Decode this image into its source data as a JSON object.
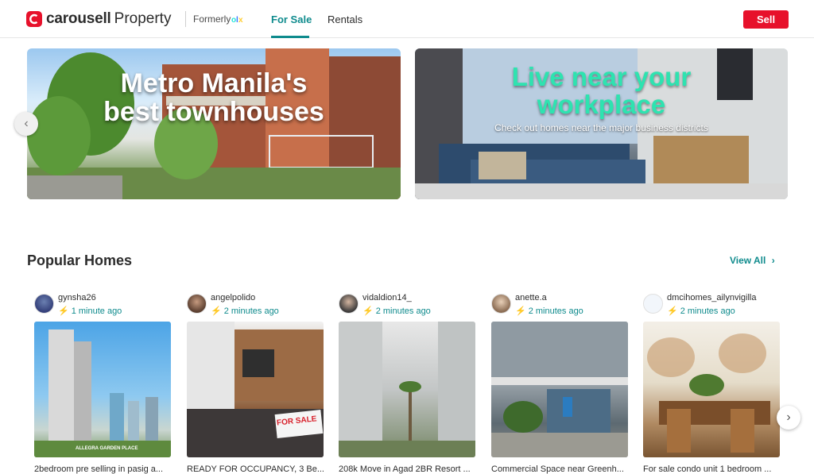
{
  "header": {
    "logo_text": "carousell",
    "logo_sub": "Property",
    "formerly": "Formerly",
    "olx": "OLX",
    "tabs": [
      {
        "label": "For Sale",
        "active": true
      },
      {
        "label": "Rentals",
        "active": false
      }
    ],
    "sell_label": "Sell"
  },
  "banners": [
    {
      "title_line1": "Metro Manila's",
      "title_line2": "best townhouses"
    },
    {
      "title_line1": "Live near your",
      "title_line2": "workplace",
      "subtitle": "Check out homes near the major business districts"
    }
  ],
  "section": {
    "title": "Popular Homes",
    "view_all": "View All"
  },
  "listings": [
    {
      "username": "gynsha26",
      "time": "1 minute ago",
      "caption": "2bedroom pre selling in pasig a...",
      "photo_label": "ALLEGRA GARDEN PLACE"
    },
    {
      "username": "angelpolido",
      "time": "2 minutes ago",
      "caption": "READY FOR OCCUPANCY, 3 Be...",
      "photo_label": "FOR SALE"
    },
    {
      "username": "vidaldion14_",
      "time": "2 minutes ago",
      "caption": "208k Move in Agad 2BR Resort ..."
    },
    {
      "username": "anette.a",
      "time": "2 minutes ago",
      "caption": "Commercial Space near Greenh..."
    },
    {
      "username": "dmcihomes_ailynvigilla",
      "time": "2 minutes ago",
      "caption": "For sale condo unit 1 bedroom ..."
    }
  ],
  "colors": {
    "brand_red": "#e7112b",
    "accent_teal": "#0f8b8d",
    "banner2_title": "#2ee3b0"
  }
}
